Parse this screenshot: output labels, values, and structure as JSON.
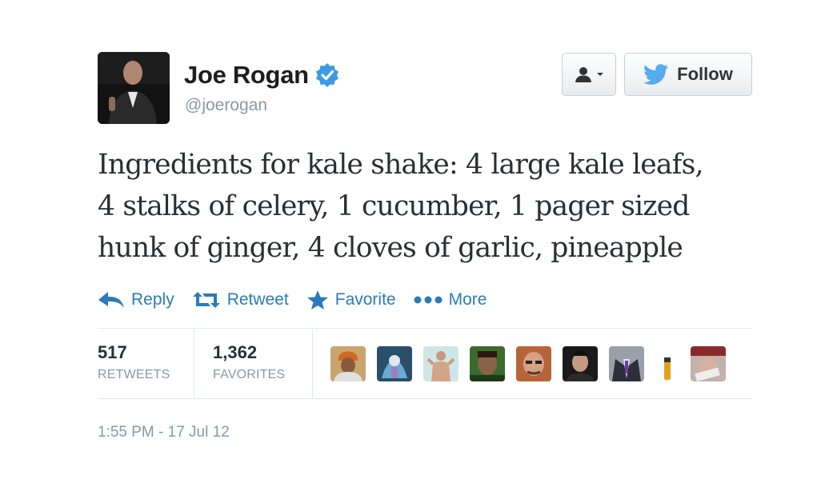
{
  "user": {
    "name": "Joe Rogan",
    "handle": "@joerogan"
  },
  "buttons": {
    "follow_label": "Follow"
  },
  "tweet": {
    "lines": [
      "Ingredients for kale shake: 4 large kale leafs,",
      "4 stalks of celery, 1 cucumber, 1 pager sized",
      "hunk of ginger, 4 cloves of garlic, pineapple"
    ]
  },
  "actions": [
    {
      "label": "Reply",
      "icon": "reply-icon"
    },
    {
      "label": "Retweet",
      "icon": "retweet-icon"
    },
    {
      "label": "Favorite",
      "icon": "star-icon"
    },
    {
      "label": "More",
      "icon": "more-dots-icon"
    }
  ],
  "stats": {
    "retweets": {
      "value": "517",
      "label": "RETWEETS"
    },
    "favorites": {
      "value": "1,362",
      "label": "FAVORITES"
    }
  },
  "timestamp": "1:55 PM - 17 Jul 12",
  "colors": {
    "link": "#2b7bb9",
    "verified": "#3b9ae1",
    "twitter_blue": "#55acee",
    "muted": "#8899a6"
  }
}
